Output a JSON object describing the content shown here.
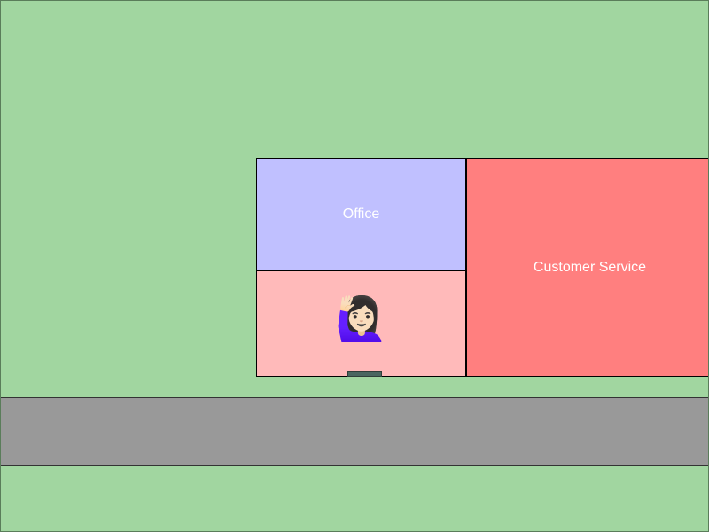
{
  "colors": {
    "grass": "#a1d6a0",
    "road": "#999999",
    "office": "#c0c0ff",
    "lobby": "#ffbaba",
    "customer_service": "#ff7f7f",
    "door": "#4a6660",
    "label": "#ffffff"
  },
  "rooms": {
    "office": {
      "label": "Office"
    },
    "customer_service": {
      "label": "Customer Service"
    },
    "lobby": {
      "label": ""
    }
  },
  "character": {
    "glyph": "🙋🏻‍♀️",
    "icon": "woman-raising-hand-icon"
  }
}
